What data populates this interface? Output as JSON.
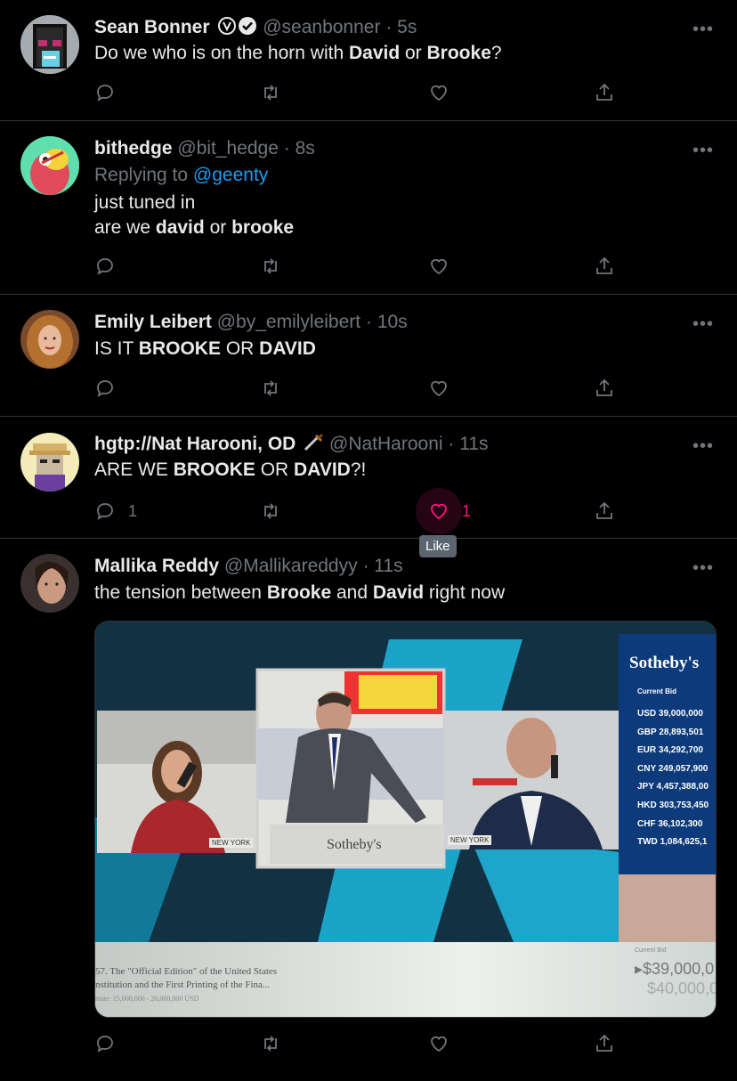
{
  "tweets": [
    {
      "name": "Sean Bonner",
      "handle": "@seanbonner",
      "time": "5s",
      "text_parts": [
        "Do we who is on the horn with ",
        "David",
        " or ",
        "Brooke",
        "?"
      ],
      "reply_count": "",
      "like_count": ""
    },
    {
      "name": "bithedge",
      "handle": "@bit_hedge",
      "time": "8s",
      "replying_prefix": "Replying to ",
      "replying_handle": "@geenty",
      "line1": "just tuned in",
      "line2_parts": [
        "are we ",
        "david",
        " or ",
        "brooke"
      ]
    },
    {
      "name": "Emily Leibert",
      "handle": "@by_emilyleibert",
      "time": "10s",
      "text_parts": [
        "IS IT ",
        "BROOKE",
        " OR ",
        "DAVID"
      ]
    },
    {
      "name": "hgtp://Nat Harooni, OD",
      "handle": "@NatHarooni",
      "time": "11s",
      "text_parts": [
        "ARE WE ",
        "BROOKE",
        " OR ",
        "DAVID",
        "?!"
      ],
      "reply_count": "1",
      "like_count": "1",
      "tooltip": "Like"
    },
    {
      "name": "Mallika Reddy",
      "handle": "@Mallikareddyy",
      "time": "11s",
      "text_parts": [
        "the tension between ",
        "Brooke",
        " and ",
        "David",
        " right now"
      ]
    }
  ],
  "separator": "·",
  "more_label": "•••",
  "media": {
    "brand": "Sotheby's",
    "current_bid_label": "Current Bid",
    "bids": [
      {
        "cur": "USD",
        "val": "39,000,000"
      },
      {
        "cur": "GBP",
        "val": "28,893,501"
      },
      {
        "cur": "EUR",
        "val": "34,292,700"
      },
      {
        "cur": "CNY",
        "val": "249,057,900"
      },
      {
        "cur": "JPY",
        "val": "4,457,388,00"
      },
      {
        "cur": "HKD",
        "val": "303,753,450"
      },
      {
        "cur": "CHF",
        "val": "36,102,300"
      },
      {
        "cur": "TWD",
        "val": "1,084,625,1"
      }
    ],
    "location_left": "NEW YORK",
    "location_right": "NEW YORK",
    "podium": "Sotheby's",
    "lot_line1": "57. The \"Official Edition\" of the United States",
    "lot_line2": "nstitution and the First Printing of the Fina...",
    "lot_line3": "mate: 15,000,000 - 20,000,000 USD",
    "bottom_bid_label": "Current Bid",
    "bottom_bid_1": "▸$39,000,0",
    "bottom_bid_2": "$40,000,0"
  },
  "colors": {
    "background": "#000000",
    "text": "#e7e9ea",
    "muted": "#71767b",
    "link": "#1d9bf0",
    "like": "#f91880",
    "border": "#2f3336"
  }
}
